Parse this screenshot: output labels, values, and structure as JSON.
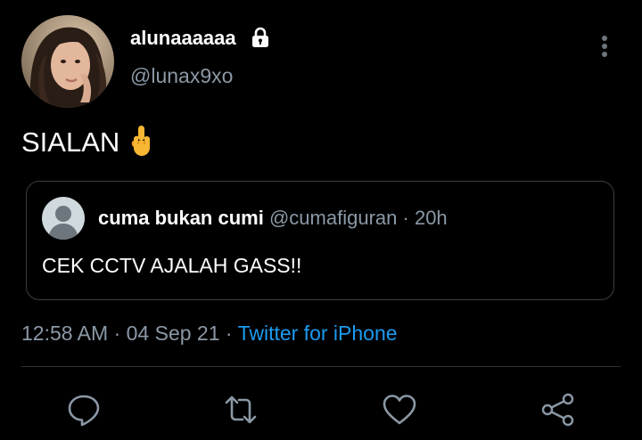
{
  "tweet": {
    "display_name": "alunaaaaaa",
    "handle": "@lunax9xo",
    "text": "SIALAN",
    "emoji_icon": "middle-finger-emoji",
    "timestamp_time": "12:58 AM",
    "timestamp_date": "04 Sep 21",
    "separator": "·",
    "source": "Twitter for iPhone"
  },
  "quote": {
    "display_name": "cuma bukan cumi",
    "handle": "@cumafiguran",
    "separator": "·",
    "time": "20h",
    "text": "CEK CCTV AJALAH GASS!!"
  },
  "actions": [
    "reply-icon",
    "retweet-icon",
    "like-icon",
    "share-icon"
  ],
  "colors": {
    "background": "#000000",
    "text": "#ffffff",
    "muted": "#8b98a5",
    "link": "#1d9bf0",
    "border": "#2f3336"
  }
}
